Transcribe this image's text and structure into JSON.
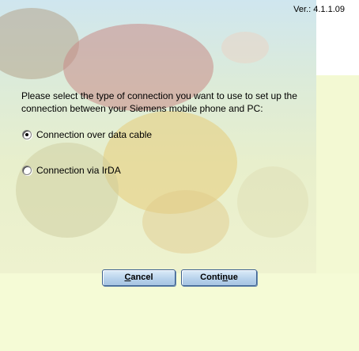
{
  "header": {
    "version": "Ver.: 4.1.1.09"
  },
  "main": {
    "prompt": "Please select the type of connection you want to use to set up the connection between your Siemens mobile phone and PC:",
    "options": [
      {
        "label": "Connection over data cable",
        "checked": true
      },
      {
        "label": "Connection via IrDA",
        "checked": false
      }
    ]
  },
  "buttons": {
    "cancel": {
      "pre": "",
      "accel": "C",
      "post": "ancel"
    },
    "continue": {
      "pre": "Conti",
      "accel": "n",
      "post": "ue"
    }
  },
  "colors": {
    "button_border": "#3a5f8f",
    "button_fill": "#b9d3ec",
    "background": "#f5fbd6"
  }
}
